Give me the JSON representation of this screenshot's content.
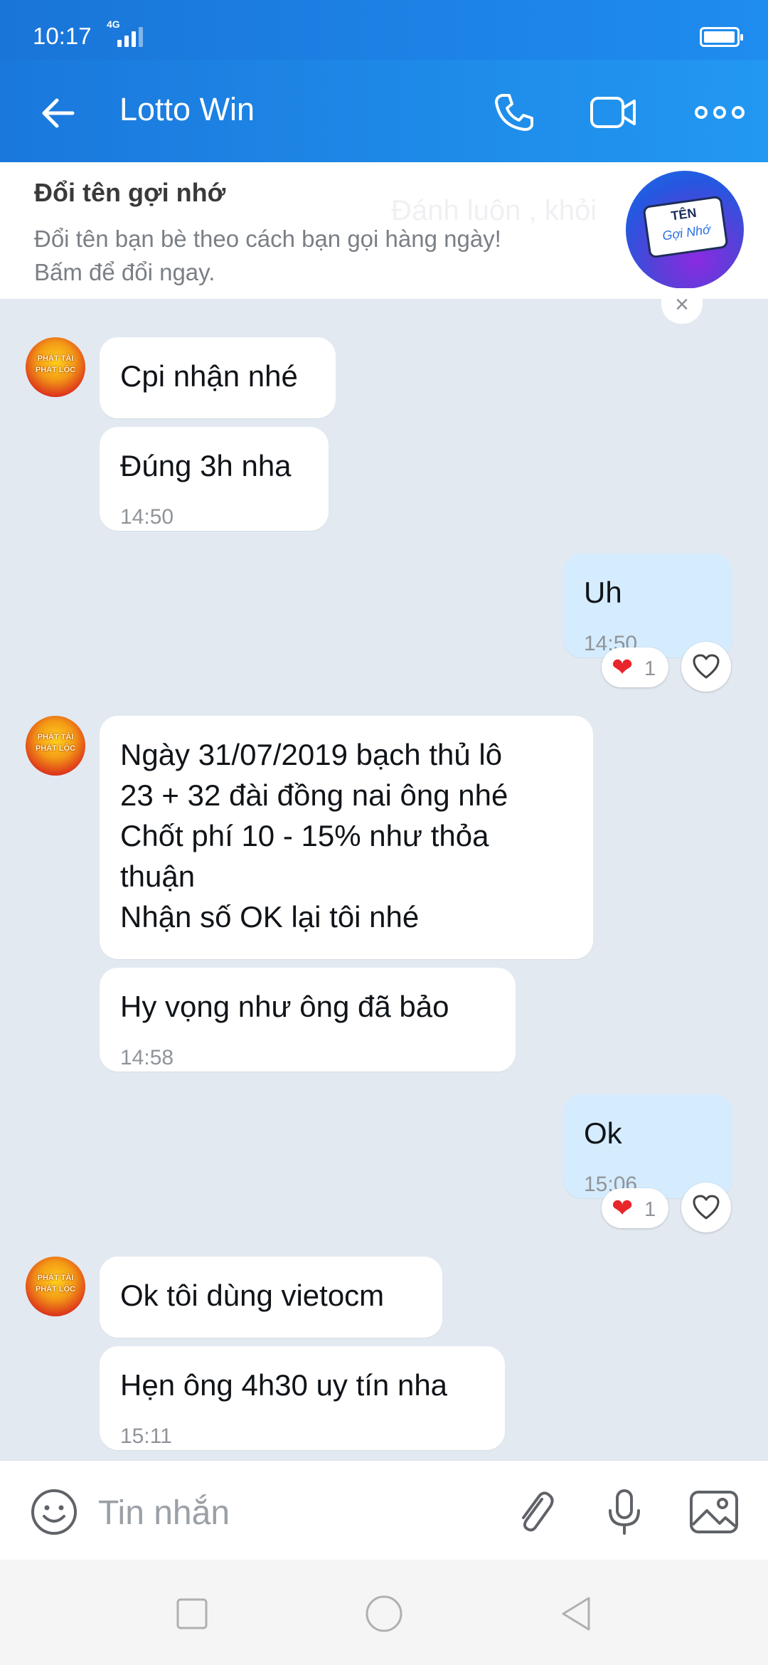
{
  "status": {
    "time": "10:17",
    "network": "4G"
  },
  "header": {
    "title": "Lotto Win"
  },
  "banner": {
    "title": "Đổi tên gợi nhớ",
    "desc_line1": "Đổi tên bạn bè theo cách bạn gọi hàng ngày!",
    "desc_line2": "Bấm để đổi ngay.",
    "ghost": "Đánh luôn , khỏi",
    "image_text_top": "TÊN",
    "image_text_bottom": "Gợi Nhớ",
    "close": "×"
  },
  "avatar_text": {
    "line1": "PHÁT TÀI",
    "line2": "PHÁT LỘC"
  },
  "messages": [
    {
      "dir": "in",
      "text": "Cpi nhận nhé",
      "time": ""
    },
    {
      "dir": "in",
      "text": "Đúng 3h nha",
      "time": "14:50"
    },
    {
      "dir": "out",
      "text": "Uh",
      "time": "14:50",
      "reaction_count": "1"
    },
    {
      "dir": "in",
      "text": "Ngày 31/07/2019 bạch thủ lô\n23 + 32 đài đồng nai ông nhé\nChốt phí 10 - 15% như thỏa\nthuận\nNhận số OK lại tôi nhé",
      "time": ""
    },
    {
      "dir": "in",
      "text": "Hy vọng như ông đã bảo",
      "time": "14:58"
    },
    {
      "dir": "out",
      "text": "Ok",
      "time": "15:06",
      "reaction_count": "1"
    },
    {
      "dir": "in",
      "text": "Ok tôi dùng vietocm",
      "time": ""
    },
    {
      "dir": "in",
      "text": "Hẹn ông 4h30 uy tín nha",
      "time": "15:11"
    }
  ],
  "input": {
    "placeholder": "Tin nhắn"
  },
  "icons": {
    "back": "arrow-left-icon",
    "call": "phone-icon",
    "video": "video-camera-icon",
    "more": "more-dots-icon",
    "emoji": "emoji-icon",
    "attach": "paperclip-icon",
    "mic": "microphone-icon",
    "image": "image-icon"
  },
  "colors": {
    "header": "#1f8cf0",
    "chat_bg": "#e2e9f1",
    "outgoing_bubble": "#d4ecfe",
    "heart": "#e8252b"
  }
}
